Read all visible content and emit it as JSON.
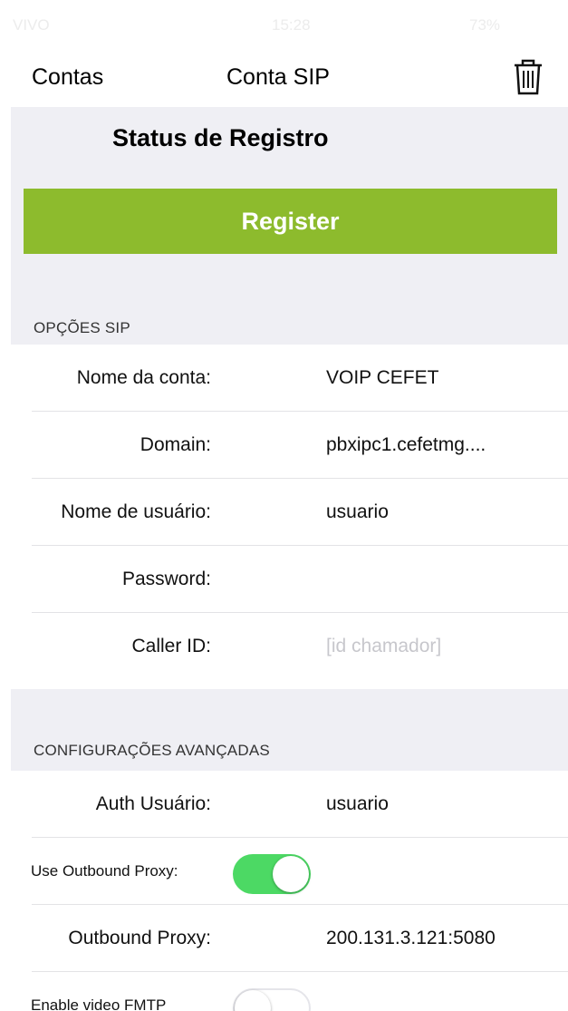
{
  "status_bar": {
    "carrier": "VIVO",
    "time": "15:28",
    "battery": "73%"
  },
  "nav": {
    "back_label": "Contas",
    "title": "Conta SIP",
    "trash_icon": "trash-icon"
  },
  "status": {
    "title": "Status de Registro",
    "register_label": "Register",
    "register_color": "#8dbb2d"
  },
  "sip_options": {
    "header": "OPÇÕES SIP",
    "rows": [
      {
        "label": "Nome da conta:",
        "value": "VOIP CEFET"
      },
      {
        "label": "Domain:",
        "value": "pbxipc1.cefetmg...."
      },
      {
        "label": "Nome de usuário:",
        "value": "usuario"
      },
      {
        "label": "Password:",
        "value": ""
      },
      {
        "label": "Caller ID:",
        "placeholder": "[id chamador]"
      }
    ]
  },
  "advanced": {
    "header": "CONFIGURAÇÕES AVANÇADAS",
    "auth_label": "Auth Usuário:",
    "auth_value": "usuario",
    "outbound_toggle_label": "Use Outbound Proxy:",
    "outbound_toggle_on": true,
    "outbound_proxy_label": "Outbound Proxy:",
    "outbound_proxy_value": "200.131.3.121:5080",
    "video_fmtp_label": "Enable video FMTP",
    "video_fmtp_on": false,
    "toggle_on_color": "#4cd964"
  }
}
